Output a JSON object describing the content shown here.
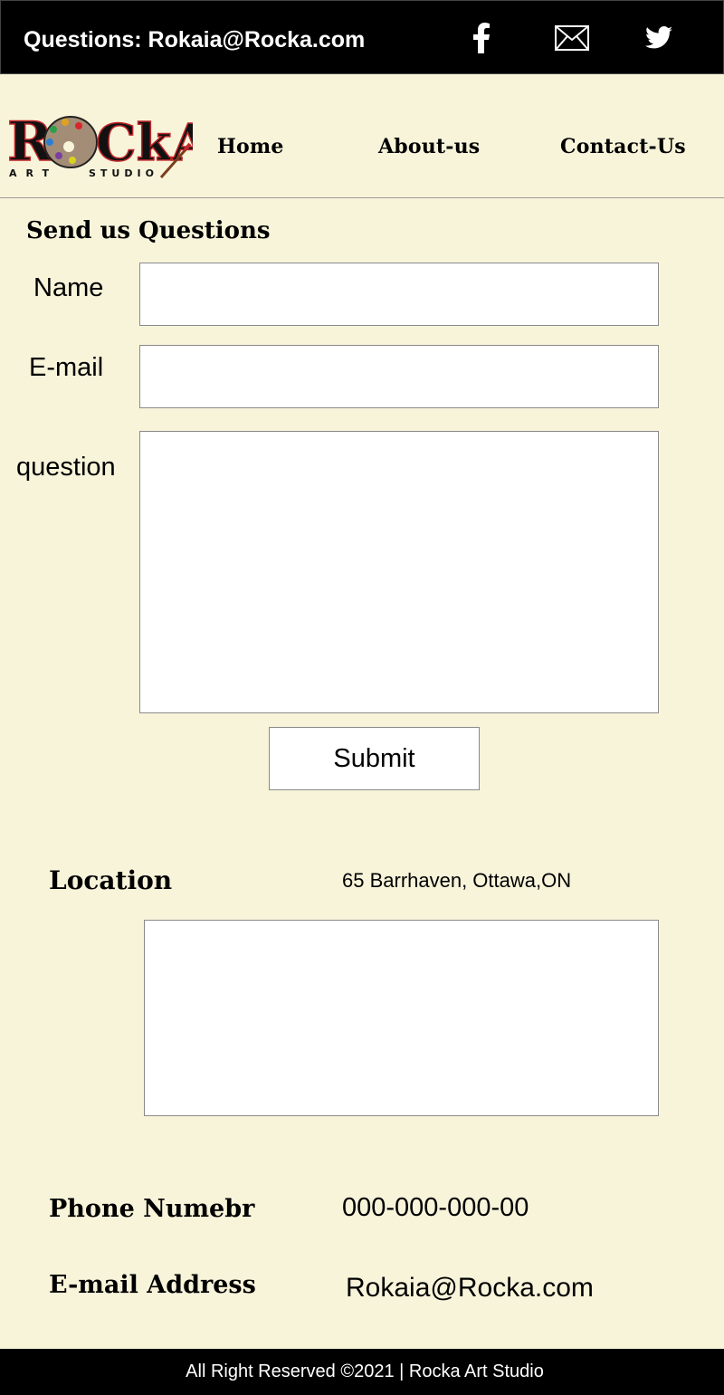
{
  "topbar": {
    "questions_text": "Questions: Rokaia@Rocka.com",
    "icons": [
      "facebook-icon",
      "mail-icon",
      "twitter-icon"
    ]
  },
  "logo": {
    "brand": "ROCkA",
    "tagline": "ART STUDIO"
  },
  "nav": {
    "home": "Home",
    "about": "About-us",
    "contact": "Contact-Us"
  },
  "form": {
    "title": "Send us Questions",
    "name_label": "Name",
    "email_label": "E-mail",
    "question_label": "question",
    "name_value": "",
    "email_value": "",
    "question_value": "",
    "submit_label": "Submit"
  },
  "location": {
    "title": "Location",
    "address": "65 Barrhaven, Ottawa,ON"
  },
  "contact": {
    "phone_title": "Phone Numebr",
    "phone_value": "000-000-000-00",
    "email_title": "E-mail Address",
    "email_value": "Rokaia@Rocka.com"
  },
  "footer": {
    "text": "All Right Reserved ©2021 | Rocka Art Studio"
  },
  "colors": {
    "background": "#f8f4da",
    "bar": "#000000",
    "palette_dots": [
      "#2e9e4a",
      "#e0a21e",
      "#d8262c",
      "#2c7fd0",
      "#7a3fa0",
      "#d8d21e"
    ]
  }
}
